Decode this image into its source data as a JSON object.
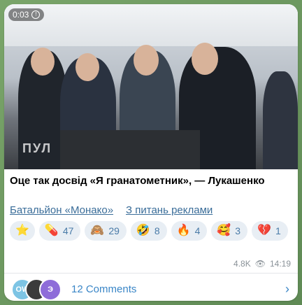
{
  "video": {
    "duration": "0:03",
    "watermark": "ПУЛ"
  },
  "post": {
    "caption": "Оце так досвід «Я гранатометник», — Лукашенко",
    "links": [
      {
        "label": "Батальйон «Монако»"
      },
      {
        "label": "З питань реклами"
      }
    ]
  },
  "reactions": [
    {
      "icon": "star-icon",
      "emoji": "⭐",
      "count": ""
    },
    {
      "icon": "pill-icon",
      "emoji": "💊",
      "count": "47"
    },
    {
      "icon": "monkey-icon",
      "emoji": "🙈",
      "count": "29"
    },
    {
      "icon": "face-icon",
      "emoji": "🤣",
      "count": "8"
    },
    {
      "icon": "fire-icon",
      "emoji": "🔥",
      "count": "4"
    },
    {
      "icon": "love-face-icon",
      "emoji": "🥰",
      "count": "3"
    },
    {
      "icon": "heart-icon",
      "emoji": "💔",
      "count": "1"
    }
  ],
  "meta": {
    "views": "4.8K",
    "time": "14:19"
  },
  "comments": {
    "label": "12 Comments",
    "avatars": [
      {
        "initials": "OW",
        "color": "#7dc4e4"
      },
      {
        "initials": "",
        "color": "#3b3b3b"
      },
      {
        "initials": "Э",
        "color": "#8e6cd9"
      }
    ]
  }
}
